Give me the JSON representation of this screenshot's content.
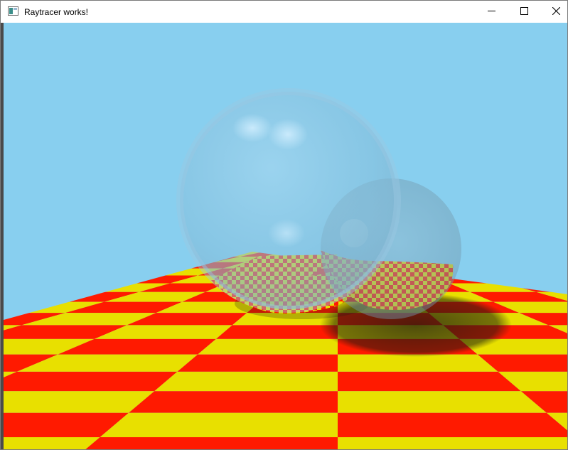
{
  "window": {
    "title": "Raytracer works!"
  },
  "icons": {
    "app": "app-window-icon",
    "minimize": "minimize-icon",
    "maximize": "maximize-icon",
    "close": "close-icon"
  },
  "scene": {
    "sky_color": "#88cfef",
    "checker_color_a": "#ff1a00",
    "checker_color_b": "#e8e000",
    "sphere_tint": "#9cc8e2",
    "shadow_color": "#2a2a1a"
  }
}
